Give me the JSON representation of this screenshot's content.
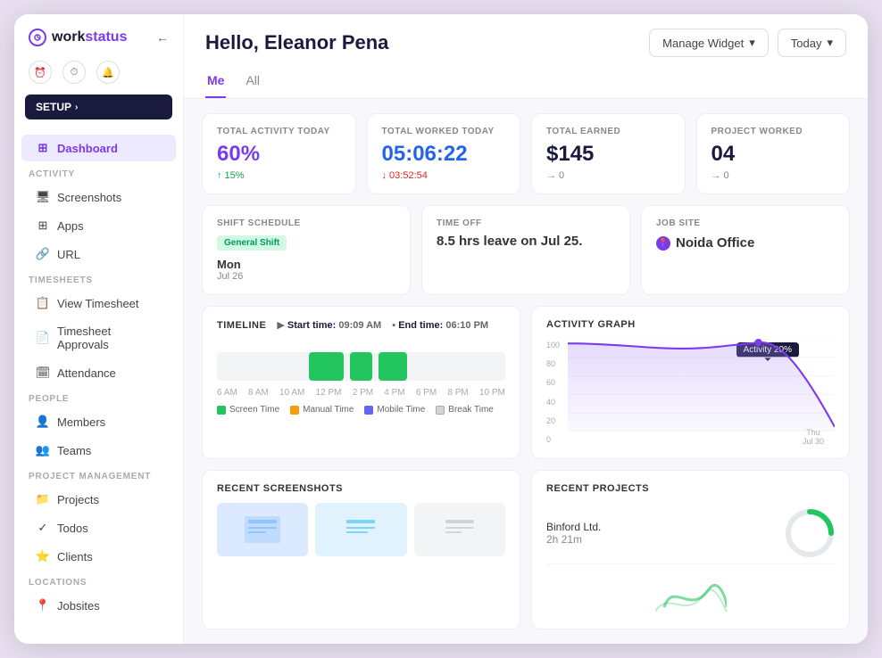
{
  "app": {
    "name": "workstatus",
    "logo_icon": "⏱"
  },
  "sidebar": {
    "setup_label": "SETUP",
    "collapse_icon": "←",
    "icon1": "⏰",
    "icon2": "⏱",
    "icon3": "🔔",
    "nav_active": "Dashboard",
    "sections": [
      {
        "label": "",
        "items": [
          {
            "id": "dashboard",
            "label": "Dashboard",
            "icon": "⊞",
            "active": true
          }
        ]
      },
      {
        "label": "ACTIVITY",
        "items": [
          {
            "id": "screenshots",
            "label": "Screenshots",
            "icon": "🖥"
          },
          {
            "id": "apps",
            "label": "Apps",
            "icon": "⊞"
          },
          {
            "id": "url",
            "label": "URL",
            "icon": "🔗"
          }
        ]
      },
      {
        "label": "TIMESHEETS",
        "items": [
          {
            "id": "view-timesheet",
            "label": "View Timesheet",
            "icon": "📋"
          },
          {
            "id": "timesheet-approvals",
            "label": "Timesheet Approvals",
            "icon": "📄"
          },
          {
            "id": "attendance",
            "label": "Attendance",
            "icon": "🗓"
          }
        ]
      },
      {
        "label": "PEOPLE",
        "items": [
          {
            "id": "members",
            "label": "Members",
            "icon": "👤"
          },
          {
            "id": "teams",
            "label": "Teams",
            "icon": "👥"
          }
        ]
      },
      {
        "label": "PROJECT MANAGEMENT",
        "items": [
          {
            "id": "projects",
            "label": "Projects",
            "icon": "📁"
          },
          {
            "id": "todos",
            "label": "Todos",
            "icon": "✓"
          },
          {
            "id": "clients",
            "label": "Clients",
            "icon": "⭐"
          }
        ]
      },
      {
        "label": "LOCATIONS",
        "items": [
          {
            "id": "jobsites",
            "label": "Jobsites",
            "icon": "📍"
          }
        ]
      }
    ]
  },
  "header": {
    "greeting": "Hello, Eleanor Pena",
    "manage_widget_label": "Manage Widget",
    "today_label": "Today",
    "tab_me": "Me",
    "tab_all": "All"
  },
  "stats": [
    {
      "id": "total-activity",
      "label": "TOTAL ACTIVITY TODAY",
      "value": "60%",
      "value_class": "purple",
      "sub": "↑ 15%",
      "sub_class": "up"
    },
    {
      "id": "total-worked",
      "label": "TOTAL WORKED TODAY",
      "value": "05:06:22",
      "value_class": "blue",
      "sub": "↓ 03:52:54",
      "sub_class": "down"
    },
    {
      "id": "total-earned",
      "label": "TOTAL EARNED",
      "value": "$145",
      "value_class": "dark",
      "sub": "→ 0",
      "sub_class": "neutral"
    },
    {
      "id": "project-worked",
      "label": "PROJECT WORKED",
      "value": "04",
      "value_class": "dark",
      "sub": "→ 0",
      "sub_class": "neutral"
    }
  ],
  "shift": {
    "label": "SHIFT SCHEDULE",
    "badge": "General Shift",
    "day": "Mon",
    "date": "Jul 26"
  },
  "timeoff": {
    "label": "TIME OFF",
    "value": "8.5 hrs leave on Jul 25."
  },
  "jobsite": {
    "label": "JOB SITE",
    "value": "Noida Office"
  },
  "timeline": {
    "label": "TIMELINE",
    "start_label": "Start time:",
    "start_value": "09:09 AM",
    "end_label": "End time:",
    "end_value": "06:10 PM",
    "x_labels": [
      "6 AM",
      "8 AM",
      "10 AM",
      "12 PM",
      "2 PM",
      "4 PM",
      "6 PM",
      "8 PM",
      "10 PM"
    ],
    "legend": [
      {
        "label": "Screen Time",
        "color": "#22c55e"
      },
      {
        "label": "Manual Time",
        "color": "#f59e0b"
      },
      {
        "label": "Mobile Time",
        "color": "#6366f1"
      },
      {
        "label": "Break Time",
        "color": "#e5e7eb"
      }
    ],
    "bars": [
      {
        "left": "32%",
        "width": "12%",
        "color": "#22c55e"
      },
      {
        "left": "46%",
        "width": "8%",
        "color": "#22c55e"
      },
      {
        "left": "56%",
        "width": "10%",
        "color": "#22c55e"
      }
    ]
  },
  "activity_graph": {
    "label": "ACTIVITY GRAPH",
    "tooltip": "Activity 20%",
    "y_labels": [
      "100",
      "80",
      "60",
      "40",
      "20",
      "0"
    ],
    "x_label": "Thu\nJul 30"
  },
  "recent_screenshots": {
    "label": "RECENT SCREENSHOTS"
  },
  "recent_projects": {
    "label": "RECENT PROJECTS",
    "items": [
      {
        "name": "Binford Ltd.",
        "time": "2h 21m"
      }
    ]
  }
}
